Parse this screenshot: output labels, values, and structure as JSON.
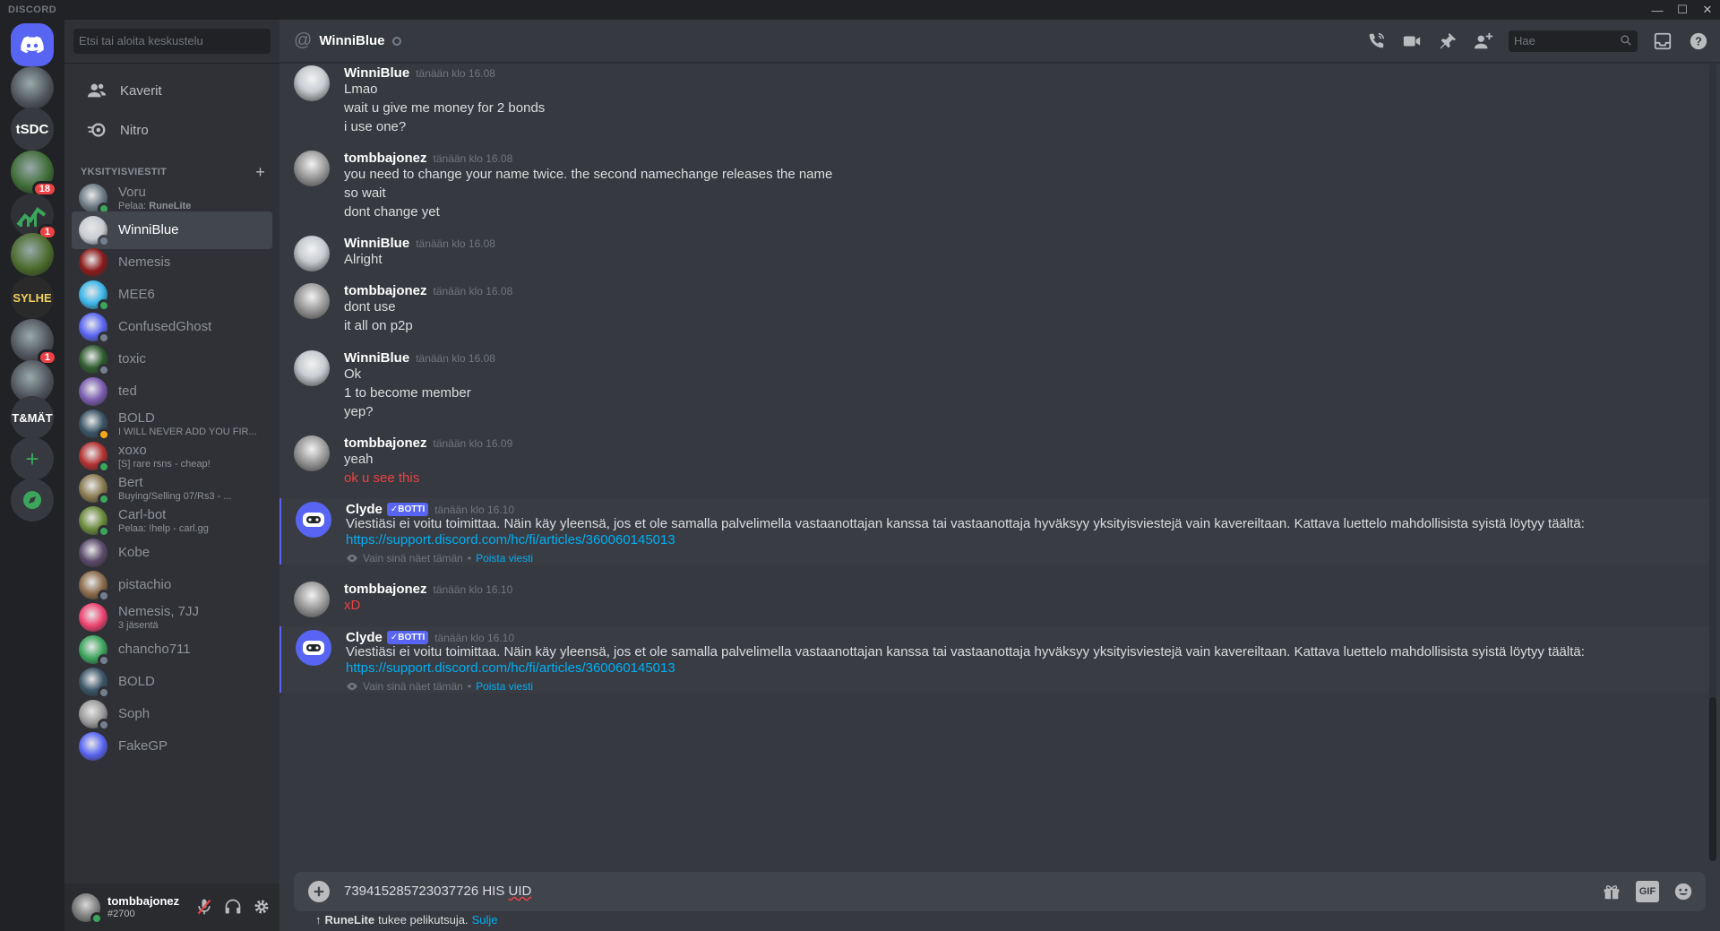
{
  "window": {
    "app_name": "DISCORD",
    "minimize": "—",
    "maximize": "☐",
    "close": "✕"
  },
  "guilds": [
    {
      "name": "home",
      "label": "",
      "color": "#5865f2"
    },
    {
      "name": "server-crow",
      "label": "",
      "color": "#4f545c"
    },
    {
      "name": "server-tsdc",
      "label": "tSDC",
      "color": "#36393f"
    },
    {
      "name": "server-green",
      "label": "",
      "color": "#3d6b35",
      "badge": "18"
    },
    {
      "name": "server-chart",
      "label": "",
      "color": "#2f3136",
      "badge": "1"
    },
    {
      "name": "server-teds",
      "label": "",
      "color": "#4a6a2a"
    },
    {
      "name": "server-sylhe",
      "label": "SYLHE",
      "color": "#2a2a2a"
    },
    {
      "name": "server-grey",
      "label": "",
      "color": "#4f545c",
      "badge": "1"
    },
    {
      "name": "server-grey2",
      "label": "",
      "color": "#4f545c"
    },
    {
      "name": "server-tmat",
      "label": "T&MÄT",
      "color": "#36393f"
    },
    {
      "name": "add-server",
      "label": "+",
      "color": "#36393f"
    },
    {
      "name": "explore",
      "label": "",
      "color": "#36393f"
    }
  ],
  "sidebar": {
    "search_placeholder": "Etsi tai aloita keskustelu",
    "nav": [
      {
        "label": "Kaverit",
        "icon": "friends-icon"
      },
      {
        "label": "Nitro",
        "icon": "nitro-icon"
      }
    ],
    "dm_header": "YKSITYISVIESTIT",
    "dms": [
      {
        "name": "Voru",
        "sub_prefix": "Pelaa: ",
        "sub_bold": "RuneLite",
        "status": "online",
        "color": "#6d7a85"
      },
      {
        "name": "WinniBlue",
        "sub_prefix": "",
        "sub_bold": "",
        "status": "offline",
        "color": "#c8ccd1",
        "active": true
      },
      {
        "name": "Nemesis",
        "sub_prefix": "",
        "sub_bold": "",
        "status": "",
        "color": "#8b1a1a"
      },
      {
        "name": "MEE6",
        "sub_prefix": "",
        "sub_bold": "",
        "status": "online",
        "color": "#3bb5e8"
      },
      {
        "name": "ConfusedGhost",
        "sub_prefix": "",
        "sub_bold": "",
        "status": "offline",
        "color": "#5865f2"
      },
      {
        "name": "toxic",
        "sub_prefix": "",
        "sub_bold": "",
        "status": "offline",
        "color": "#2f5d2f"
      },
      {
        "name": "ted",
        "sub_prefix": "",
        "sub_bold": "",
        "status": "",
        "color": "#7a5cb0"
      },
      {
        "name": "BOLD",
        "sub_prefix": "I WILL NEVER ADD YOU FIR...",
        "sub_bold": "",
        "status": "idle",
        "color": "#3a5566"
      },
      {
        "name": "xoxo",
        "sub_prefix": "[S] rare rsns - cheap!",
        "sub_bold": "",
        "status": "online",
        "color": "#b33030"
      },
      {
        "name": "Bert",
        "sub_prefix": "Buying/Selling 07/Rs3 - ...",
        "sub_bold": "",
        "status": "online",
        "color": "#8a7a50"
      },
      {
        "name": "Carl-bot",
        "sub_prefix": "Pelaa: !help - carl.gg",
        "sub_bold": "",
        "status": "online",
        "color": "#6a8a3a"
      },
      {
        "name": "Kobe",
        "sub_prefix": "",
        "sub_bold": "",
        "status": "",
        "color": "#5a4a6a"
      },
      {
        "name": "pistachio",
        "sub_prefix": "",
        "sub_bold": "",
        "status": "offline",
        "color": "#8a6a4a"
      },
      {
        "name": "Nemesis, 7JJ",
        "sub_prefix": "3 jäsentä",
        "sub_bold": "",
        "status": "",
        "color": "#ed4270"
      },
      {
        "name": "chancho711",
        "sub_prefix": "",
        "sub_bold": "",
        "status": "offline",
        "color": "#3ba55c"
      },
      {
        "name": "BOLD",
        "sub_prefix": "",
        "sub_bold": "",
        "status": "offline",
        "color": "#3a5566"
      },
      {
        "name": "Soph",
        "sub_prefix": "",
        "sub_bold": "",
        "status": "offline",
        "color": "#9a9a9a"
      },
      {
        "name": "FakeGP",
        "sub_prefix": "",
        "sub_bold": "",
        "status": "",
        "color": "#5865f2"
      }
    ]
  },
  "user": {
    "name": "tombbajonez",
    "tag": "#2700"
  },
  "chat": {
    "title": "WinniBlue",
    "search_placeholder": "Hae"
  },
  "messages": [
    {
      "author": "WinniBlue",
      "time": "tänään klo 16.08",
      "lines": [
        "Lmao",
        "wait u give me money for 2 bonds",
        "i use one?"
      ]
    },
    {
      "author": "tombbajonez",
      "time": "tänään klo 16.08",
      "lines": [
        "you need to change your name twice. the second namechange releases the name",
        "so wait",
        "dont change yet"
      ]
    },
    {
      "author": "WinniBlue",
      "time": "tänään klo 16.08",
      "lines": [
        "Alright"
      ]
    },
    {
      "author": "tombbajonez",
      "time": "tänään klo 16.08",
      "lines": [
        "dont use",
        "it all on p2p"
      ]
    },
    {
      "author": "WinniBlue",
      "time": "tänään klo 16.08",
      "lines": [
        "Ok",
        "1 to become member",
        "yep?"
      ]
    },
    {
      "author": "tombbajonez",
      "time": "tänään klo 16.09",
      "lines": [
        "yeah",
        "ok u see this"
      ],
      "red_line": 1
    },
    {
      "author": "Clyde",
      "bot_label": "BOTTI",
      "time": "tänään klo 16.10",
      "text": "Viestiäsi ei voitu toimittaa. Näin käy yleensä, jos et ole samalla palvelimella vastaanottajan kanssa tai vastaanottaja hyväksyy yksityisviestejä vain kavereiltaan. Kattava luettelo mahdollisista syistä löytyy täältä:",
      "link": "https://support.discord.com/hc/fi/articles/360060145013",
      "note": "Vain sinä näet tämän",
      "note_sep": "•",
      "delete": "Poista viesti"
    },
    {
      "author": "tombbajonez",
      "time": "tänään klo 16.10",
      "lines": [
        "xD"
      ],
      "red_line": 0
    },
    {
      "author": "Clyde",
      "bot_label": "BOTTI",
      "time": "tänään klo 16.10",
      "text": "Viestiäsi ei voitu toimittaa. Näin käy yleensä, jos et ole samalla palvelimella vastaanottajan kanssa tai vastaanottaja hyväksyy yksityisviestejä vain kavereiltaan. Kattava luettelo mahdollisista syistä löytyy täältä:",
      "link": "https://support.discord.com/hc/fi/articles/360060145013",
      "note": "Vain sinä näet tämän",
      "note_sep": "•",
      "delete": "Poista viesti"
    }
  ],
  "composer": {
    "text_main": "739415285723037726 HIS ",
    "text_flagged": "UID"
  },
  "activity": {
    "app": "RuneLite",
    "text": "tukee pelikutsuja.",
    "close": "Sulje"
  }
}
